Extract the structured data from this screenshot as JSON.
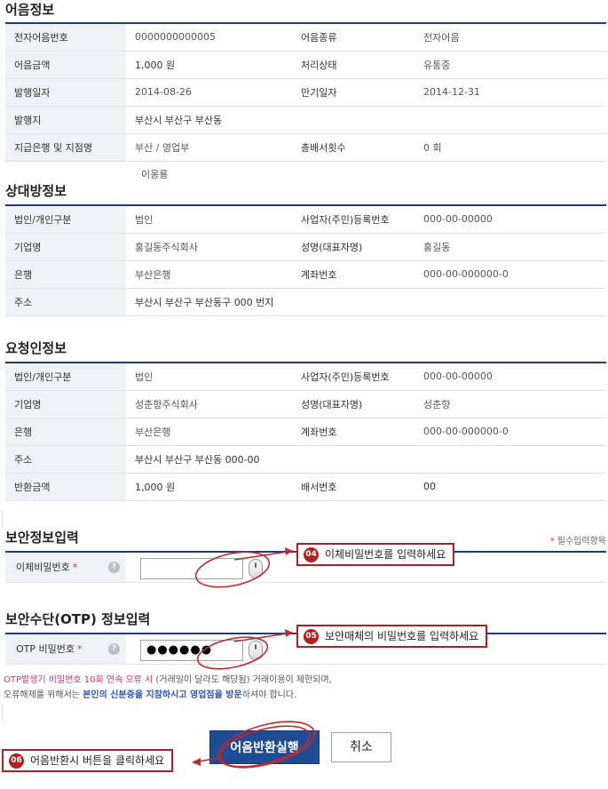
{
  "bill_info": {
    "title": "어음정보",
    "rows": [
      [
        "전자어음번호",
        "0000000000005",
        "어음종류",
        "전자어음"
      ],
      [
        "어음금액",
        "1,000 원",
        "처리상태",
        "유통중"
      ],
      [
        "발행일자",
        "2014-08-26",
        "만기일자",
        "2014-12-31"
      ],
      [
        "발행지",
        "부산시 부산구 부산동",
        "",
        ""
      ],
      [
        "지급은행 및 지점명",
        "부산 / 영업부",
        "총배서횟수",
        "0 회"
      ]
    ],
    "extra_value": "이몽룡"
  },
  "counterparty_info": {
    "title": "상대방정보",
    "rows": [
      [
        "법인/개인구분",
        "법인",
        "사업자(주민)등록번호",
        "000-00-00000"
      ],
      [
        "기업명",
        "홍길동주식회사",
        "성명(대표자명)",
        "홍길동"
      ],
      [
        "은행",
        "부산은행",
        "계좌번호",
        "000-00-000000-0"
      ],
      [
        "주소",
        "부산시 부산구 부산동구 000 번지",
        "",
        ""
      ]
    ]
  },
  "requester_info": {
    "title": "요청인정보",
    "rows": [
      [
        "법인/개인구분",
        "법인",
        "사업자(주민)등록번호",
        "000-00-00000"
      ],
      [
        "기업명",
        "성춘향주식회사",
        "성명(대표자명)",
        "성춘향"
      ],
      [
        "은행",
        "부산은행",
        "계좌번호",
        "000-00-000000-0"
      ],
      [
        "주소",
        "부산시 부산구 부산동  000-00",
        "",
        ""
      ],
      [
        "반환금액",
        "1,000 원",
        "배서번호",
        "00"
      ]
    ]
  },
  "security": {
    "title": "보안정보입력",
    "required_note": "필수입력항목",
    "required_star": "*",
    "password_label": "이체비밀번호",
    "password_value": "",
    "help_glyph": "?"
  },
  "otp": {
    "title": "보안수단(OTP) 정보입력",
    "label": "OTP 비밀번호",
    "value": "●●●●●●",
    "note_line1_pink": "OTP발생기 비밀번호 10회 연속 오류 시",
    "note_line1_rest": " (거래일이 달라도 해당됨) 거래이용이 제한되며,",
    "note_line2_a": "오류해제를 위해서는 ",
    "note_line2_blue1": "본인의 신분증을 지참하시고 영업점을 방문",
    "note_line2_b": "하셔야 합니다."
  },
  "callouts": [
    {
      "num": "04",
      "text": "이체비밀번호를 입력하세요"
    },
    {
      "num": "05",
      "text": "보안매체의 비밀번호를 입력하세요"
    },
    {
      "num": "06",
      "text": "어음반환시  버튼을 클릭하세요"
    }
  ],
  "buttons": {
    "execute": "어음반환실행",
    "cancel": "취소"
  },
  "colors": {
    "header_border": "#1e3b73",
    "label_bg": "#eef1f6",
    "primary_button": "#1f4d94",
    "annotation_red": "#b02020",
    "required_pink": "#d0334b"
  }
}
